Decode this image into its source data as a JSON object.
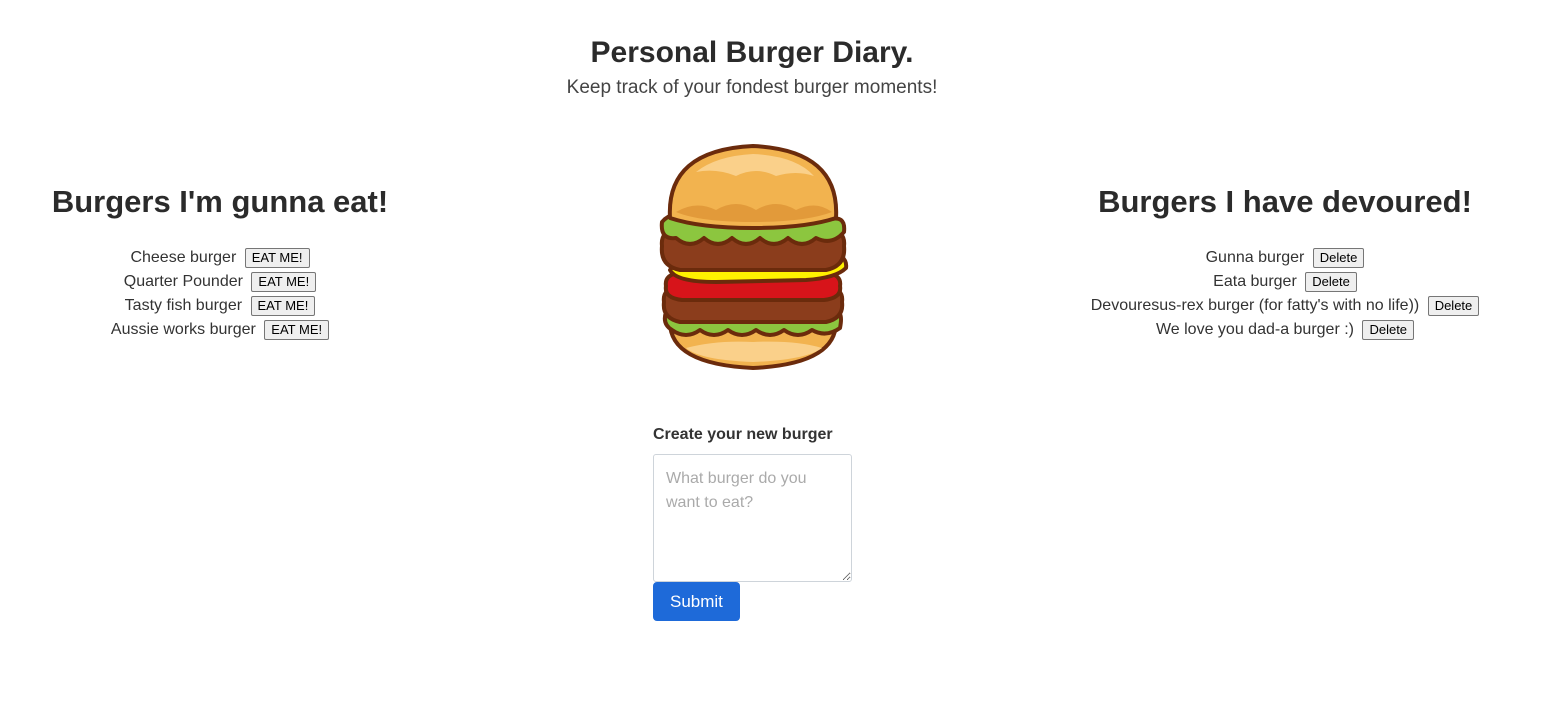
{
  "header": {
    "title": "Personal Burger Diary.",
    "subtitle": "Keep track of your fondest burger moments!"
  },
  "to_eat": {
    "heading": "Burgers I'm gunna eat!",
    "button_label": "EAT ME!",
    "items": [
      {
        "name": "Cheese burger"
      },
      {
        "name": "Quarter Pounder"
      },
      {
        "name": "Tasty fish burger"
      },
      {
        "name": "Aussie works burger"
      }
    ]
  },
  "devoured": {
    "heading": "Burgers I have devoured!",
    "button_label": "Delete",
    "items": [
      {
        "name": "Gunna burger"
      },
      {
        "name": "Eata burger"
      },
      {
        "name": "Devouresus-rex burger (for fatty's with no life))"
      },
      {
        "name": "We love you dad-a burger :)"
      }
    ]
  },
  "form": {
    "label": "Create your new burger",
    "placeholder": "What burger do you want to eat?",
    "value": "",
    "submit_label": "Submit"
  },
  "colors": {
    "primary_button": "#1e6ad9",
    "bun": "#f2b34f",
    "lettuce": "#8cc63f",
    "patty": "#8b3d1c",
    "cheese": "#fff200",
    "tomato": "#d7141a",
    "outline": "#6b2b0c"
  },
  "icons": {
    "hero_image": "hamburger-illustration"
  }
}
